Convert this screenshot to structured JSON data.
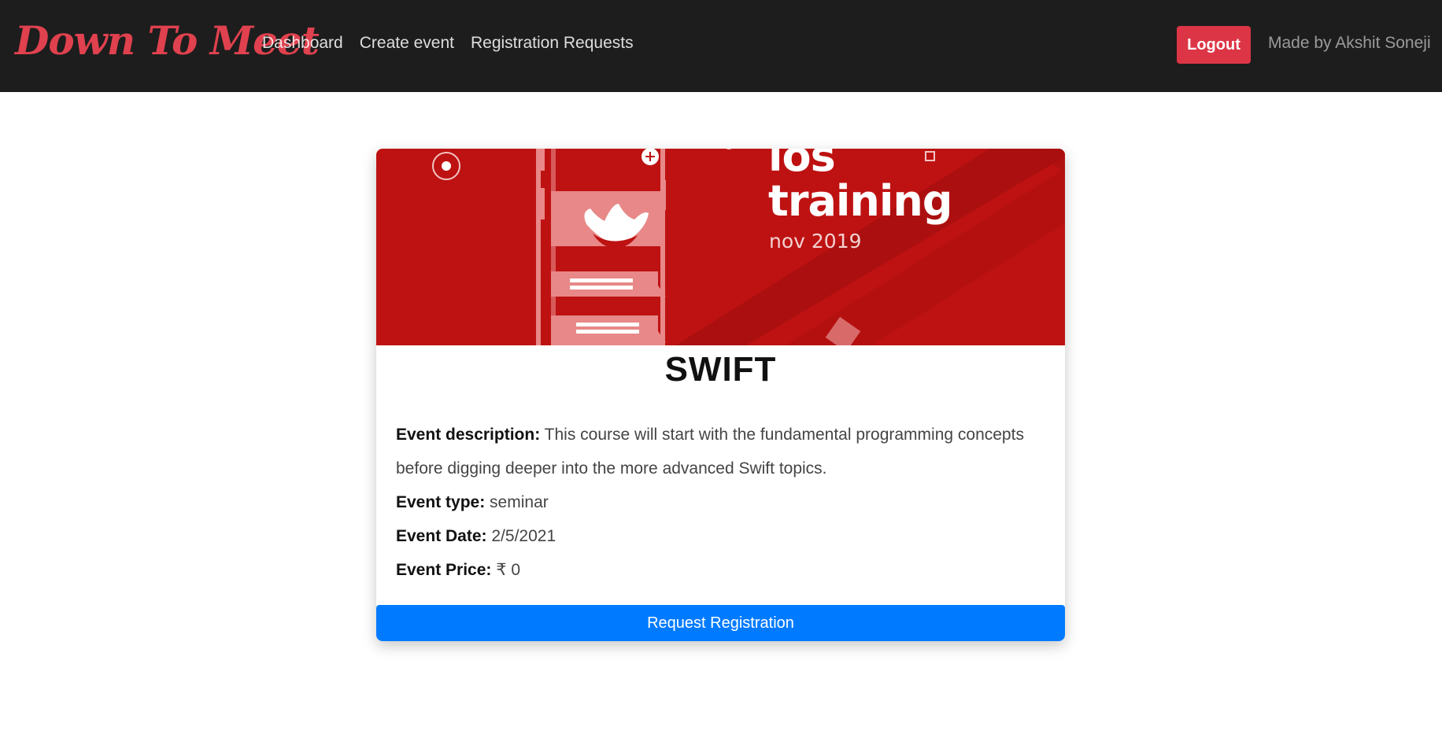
{
  "navbar": {
    "brand": "Down To Meet",
    "links": [
      "Dashboard",
      "Create event",
      "Registration Requests"
    ],
    "logout_label": "Logout",
    "credit": "Made by Akshit Soneji"
  },
  "event": {
    "banner": {
      "title_line1": "ios",
      "title_line2": "training",
      "subtitle": "nov 2019"
    },
    "title": "SWIFT",
    "description_label": "Event description:",
    "description": "This course will start with the fundamental programming concepts before digging deeper into the more advanced Swift topics.",
    "type_label": "Event type:",
    "type": "seminar",
    "date_label": "Event Date:",
    "date": "2/5/2021",
    "price_label": "Event Price:",
    "price": "₹ 0",
    "register_label": "Request Registration"
  },
  "colors": {
    "navbar_bg": "#1d1d1d",
    "brand": "#e0414e",
    "logout": "#dc3545",
    "register": "#007bff",
    "banner": "#be1212"
  }
}
